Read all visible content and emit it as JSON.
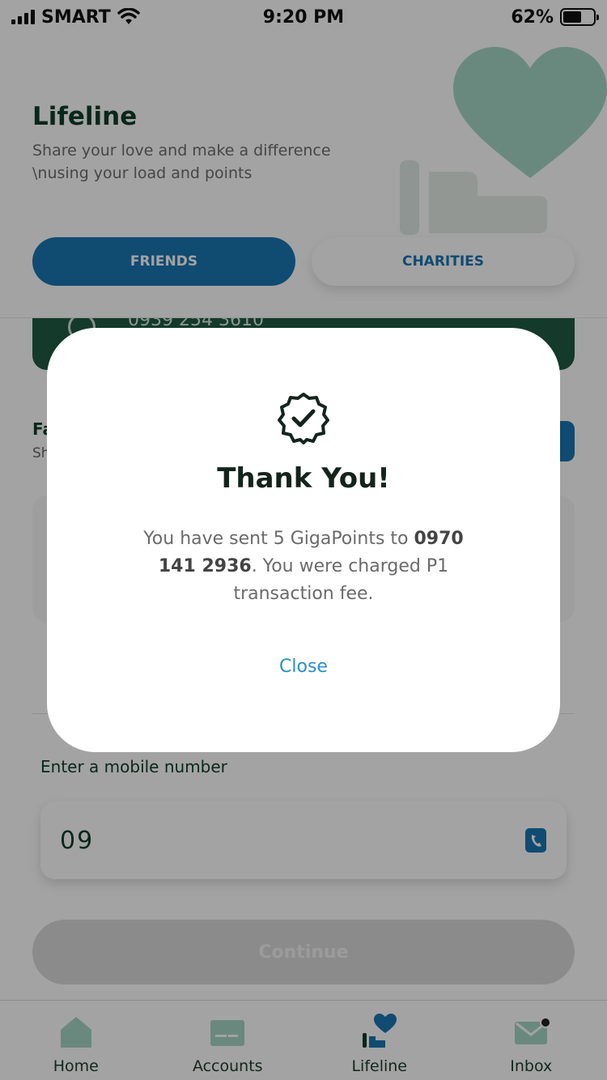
{
  "status_bar": {
    "carrier": "SMART",
    "time": "9:20 PM",
    "battery": "62%",
    "battery_level": 0.62
  },
  "header": {
    "title": "Lifeline",
    "subtitle": "Share your love and make a difference \\nusing your load and points"
  },
  "tabs": [
    {
      "label": "FRIENDS",
      "active": true
    },
    {
      "label": "CHARITIES",
      "active": false
    }
  ],
  "recent": {
    "number": "0939 254 3610"
  },
  "favorites": {
    "title": "Fa",
    "subtitle": "Sh"
  },
  "form": {
    "mobile_label": "Enter a mobile number",
    "mobile_value": "09",
    "continue_label": "Continue"
  },
  "bottom_nav": [
    {
      "label": "Home",
      "icon": "home-icon"
    },
    {
      "label": "Accounts",
      "icon": "wallet-icon"
    },
    {
      "label": "Lifeline",
      "icon": "lifeline-heart-icon",
      "active": true
    },
    {
      "label": "Inbox",
      "icon": "mail-icon",
      "has_badge": true
    }
  ],
  "modal": {
    "icon": "verified-check-icon",
    "title": "Thank You!",
    "message_part1": "You have sent 5 GigaPoints to ",
    "recipient": "0970 141 2936",
    "message_part2": ". You were charged P1 transaction fee.",
    "close_label": "Close"
  },
  "colors": {
    "primary_blue": "#1976b3",
    "dark_green": "#0f3d2a",
    "card_green": "#1e5c43",
    "link_blue": "#2a8fc4",
    "overlay": "rgba(0,0,0,0.36)"
  }
}
